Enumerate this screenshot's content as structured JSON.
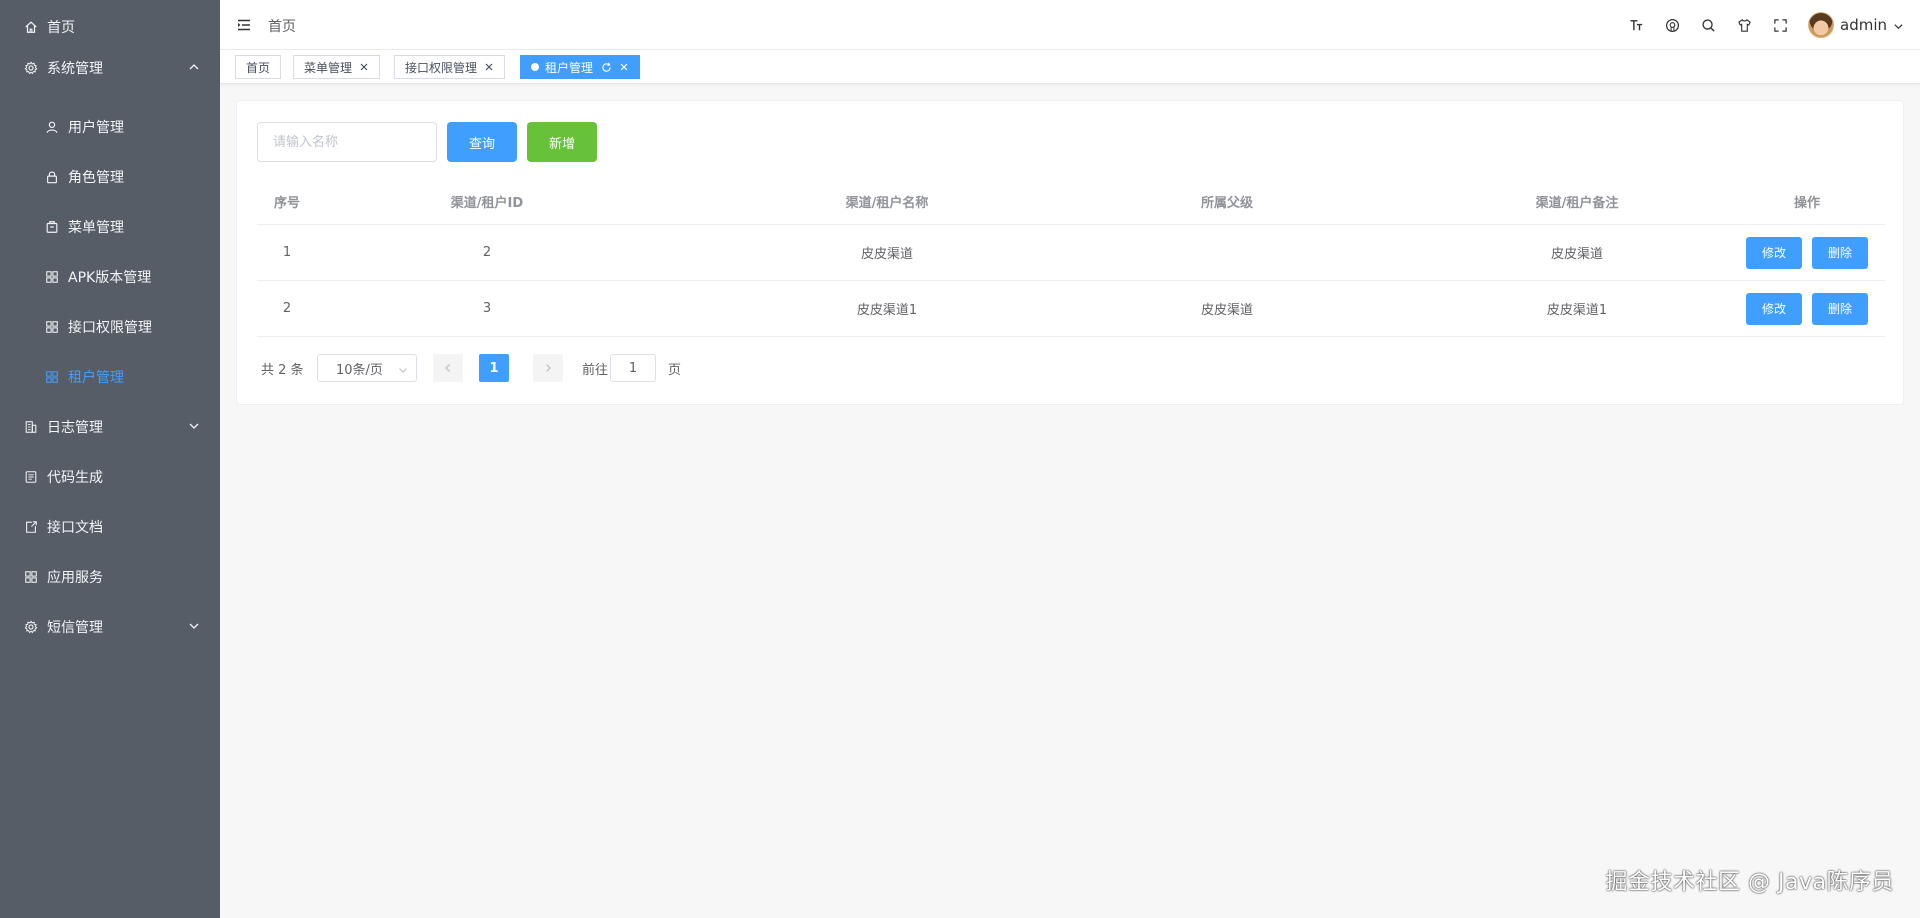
{
  "sidebar": {
    "items": [
      {
        "label": "首页",
        "icon": "home-icon"
      },
      {
        "label": "系统管理",
        "icon": "gear-icon",
        "expanded": true
      },
      {
        "label": "用户管理",
        "icon": "user-icon"
      },
      {
        "label": "角色管理",
        "icon": "lock-icon"
      },
      {
        "label": "菜单管理",
        "icon": "menu-box-icon"
      },
      {
        "label": "APK版本管理",
        "icon": "grid-icon"
      },
      {
        "label": "接口权限管理",
        "icon": "grid-icon"
      },
      {
        "label": "租户管理",
        "icon": "grid-icon",
        "active": true
      },
      {
        "label": "日志管理",
        "icon": "building-icon",
        "expanded": false
      },
      {
        "label": "代码生成",
        "icon": "code-icon"
      },
      {
        "label": "接口文档",
        "icon": "doc-icon"
      },
      {
        "label": "应用服务",
        "icon": "grid-icon"
      },
      {
        "label": "短信管理",
        "icon": "gear-icon",
        "expanded": false
      }
    ]
  },
  "navbar": {
    "breadcrumb": "首页",
    "username": "admin",
    "icons": [
      "font-size-icon",
      "github-icon",
      "search-icon",
      "theme-shirt-icon",
      "fullscreen-icon"
    ]
  },
  "tags": [
    {
      "label": "首页",
      "closable": false,
      "active": false
    },
    {
      "label": "菜单管理",
      "closable": true,
      "active": false
    },
    {
      "label": "接口权限管理",
      "closable": true,
      "active": false
    },
    {
      "label": "租户管理",
      "closable": true,
      "active": true
    }
  ],
  "toolbar": {
    "search_placeholder": "请输入名称",
    "query_label": "查询",
    "add_label": "新增"
  },
  "table": {
    "columns": [
      "序号",
      "渠道/租户ID",
      "渠道/租户名称",
      "所属父级",
      "渠道/租户备注",
      "操作"
    ],
    "rows": [
      {
        "index": "1",
        "id": "2",
        "name": "皮皮渠道",
        "parent": "",
        "remark": "皮皮渠道",
        "edit": "修改",
        "delete": "删除"
      },
      {
        "index": "2",
        "id": "3",
        "name": "皮皮渠道1",
        "parent": "皮皮渠道",
        "remark": "皮皮渠道1",
        "edit": "修改",
        "delete": "删除"
      }
    ]
  },
  "pagination": {
    "total": "共 2 条",
    "page_size": "10条/页",
    "current_page": "1",
    "goto_prefix": "前往",
    "goto_value": "1",
    "goto_suffix": "页"
  },
  "watermark": "掘金技术社区 @ Java陈序员",
  "colors": {
    "sidebar_bg": "#565d67",
    "primary": "#409eff",
    "success": "#67c23a"
  }
}
